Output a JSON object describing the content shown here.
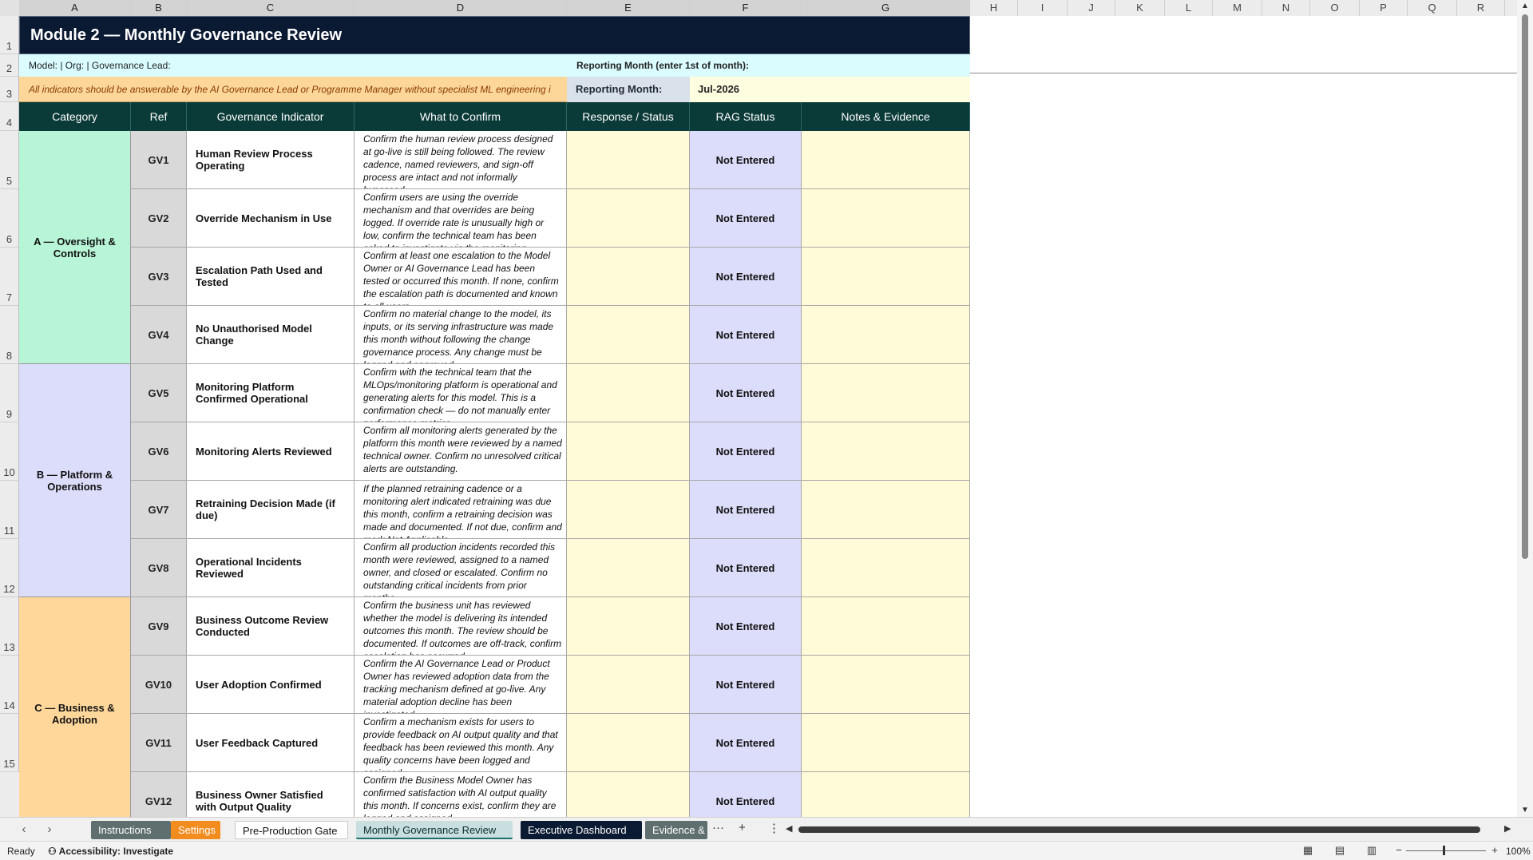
{
  "columns": [
    "A",
    "B",
    "C",
    "D",
    "E",
    "F",
    "G",
    "H",
    "I",
    "J",
    "K",
    "L",
    "M",
    "N",
    "O",
    "P",
    "Q",
    "R"
  ],
  "rows": [
    "1",
    "2",
    "3",
    "4",
    "5",
    "6",
    "7",
    "8",
    "9",
    "10",
    "11",
    "12",
    "13",
    "14",
    "15"
  ],
  "sheet": {
    "title": "Module 2 — Monthly Governance Review",
    "info_left": "Model:    |  Org:    |   Governance Lead:",
    "info_right": "Reporting Month (enter 1st of month):",
    "banner": "All indicators should be answerable by the AI Governance Lead or Programme Manager without specialist ML engineering i",
    "reporting_month_label": "Reporting Month:",
    "reporting_month_value": "Jul-2026"
  },
  "headers": {
    "category": "Category",
    "ref": "Ref",
    "indicator": "Governance Indicator",
    "confirm": "What to Confirm",
    "response": "Response / Status",
    "rag": "RAG Status",
    "notes": "Notes & Evidence"
  },
  "categories": [
    {
      "label": "A — Oversight & Controls",
      "color": "#b8f5d6"
    },
    {
      "label": "B — Platform & Operations",
      "color": "#dcdcfb"
    },
    {
      "label": "C — Business & Adoption",
      "color": "#ffd79b"
    }
  ],
  "items": [
    {
      "ref": "GV1",
      "indicator": "Human Review Process Operating",
      "confirm": "Confirm the human review process designed at go-live is still being followed. The review cadence, named reviewers, and sign-off process are intact and not informally bypassed.",
      "response": "",
      "rag": "Not Entered",
      "notes": ""
    },
    {
      "ref": "GV2",
      "indicator": "Override Mechanism in Use",
      "confirm": "Confirm users are using the override mechanism and that overrides are being logged. If override rate is unusually high or low, confirm the technical team has been asked to investigate via the monitoring",
      "response": "",
      "rag": "Not Entered",
      "notes": ""
    },
    {
      "ref": "GV3",
      "indicator": "Escalation Path Used and Tested",
      "confirm": "Confirm at least one escalation to the Model Owner or AI Governance Lead has been tested or occurred this month. If none, confirm the escalation path is documented and known to all users.",
      "response": "",
      "rag": "Not Entered",
      "notes": ""
    },
    {
      "ref": "GV4",
      "indicator": "No Unauthorised Model Change",
      "confirm": "Confirm no material change to the model, its inputs, or its serving infrastructure was made this month without following the change governance process. Any change must be logged and approved.",
      "response": "",
      "rag": "Not Entered",
      "notes": ""
    },
    {
      "ref": "GV5",
      "indicator": "Monitoring Platform Confirmed Operational",
      "confirm": "Confirm with the technical team that the MLOps/monitoring platform is operational and generating alerts for this model. This is a confirmation check — do not manually enter performance metrics.",
      "response": "",
      "rag": "Not Entered",
      "notes": ""
    },
    {
      "ref": "GV6",
      "indicator": "Monitoring Alerts Reviewed",
      "confirm": "Confirm all monitoring alerts generated by the platform this month were reviewed by a named technical owner. Confirm no unresolved critical alerts are outstanding.",
      "response": "",
      "rag": "Not Entered",
      "notes": ""
    },
    {
      "ref": "GV7",
      "indicator": "Retraining Decision Made (if due)",
      "confirm": "If the planned retraining cadence or a monitoring alert indicated retraining was due this month, confirm a retraining decision was made and documented. If not due, confirm and mark Not Applicable.",
      "response": "",
      "rag": "Not Entered",
      "notes": ""
    },
    {
      "ref": "GV8",
      "indicator": "Operational Incidents Reviewed",
      "confirm": "Confirm all production incidents recorded this month were reviewed, assigned to a named owner, and closed or escalated. Confirm no outstanding critical incidents from prior months.",
      "response": "",
      "rag": "Not Entered",
      "notes": ""
    },
    {
      "ref": "GV9",
      "indicator": "Business Outcome Review Conducted",
      "confirm": "Confirm the business unit has reviewed whether the model is delivering its intended outcomes this month. The review should be documented. If outcomes are off-track, confirm escalation has occurred.",
      "response": "",
      "rag": "Not Entered",
      "notes": ""
    },
    {
      "ref": "GV10",
      "indicator": "User Adoption Confirmed",
      "confirm": "Confirm the AI Governance Lead or Product Owner has reviewed adoption data from the tracking mechanism defined at go-live. Any material adoption decline has been investigated.",
      "response": "",
      "rag": "Not Entered",
      "notes": ""
    },
    {
      "ref": "GV11",
      "indicator": "User Feedback Captured",
      "confirm": "Confirm a mechanism exists for users to provide feedback on AI output quality and that feedback has been reviewed this month. Any quality concerns have been logged and assigned.",
      "response": "",
      "rag": "Not Entered",
      "notes": ""
    },
    {
      "ref": "GV12",
      "indicator": "Business Owner Satisfied with Output Quality",
      "confirm": "Confirm the Business Model Owner has confirmed satisfaction with AI output quality this month. If concerns exist, confirm they are logged and assigned.",
      "response": "",
      "rag": "Not Entered",
      "notes": ""
    }
  ],
  "tabs": [
    {
      "label": "Instructions",
      "bg": "#5f6f6f",
      "fg": "#ffffff"
    },
    {
      "label": "Settings",
      "bg": "#f28c1f",
      "fg": "#ffffff"
    },
    {
      "label": "Pre-Production Gate",
      "bg": "#ffffff",
      "fg": "#111111"
    },
    {
      "label": "Monthly Governance Review",
      "bg": "#c9dede",
      "fg": "#0b2e2e"
    },
    {
      "label": "Executive Dashboard",
      "bg": "#0b1a33",
      "fg": "#ffffff"
    },
    {
      "label": "Evidence &",
      "bg": "#5f6f6f",
      "fg": "#ffffff"
    }
  ],
  "tab_controls": {
    "more": "···",
    "add": "+",
    "menu": "⋮"
  },
  "status": {
    "ready": "Ready",
    "accessibility": "Accessibility: Investigate",
    "zoom": "100%"
  },
  "colors": {
    "title_bg": "#0b1a33",
    "header_bg": "#0b3b38",
    "input_cell": "#fffbd8",
    "rag_cell": "#dcdcfb",
    "banner_bg": "#fdd69a"
  }
}
